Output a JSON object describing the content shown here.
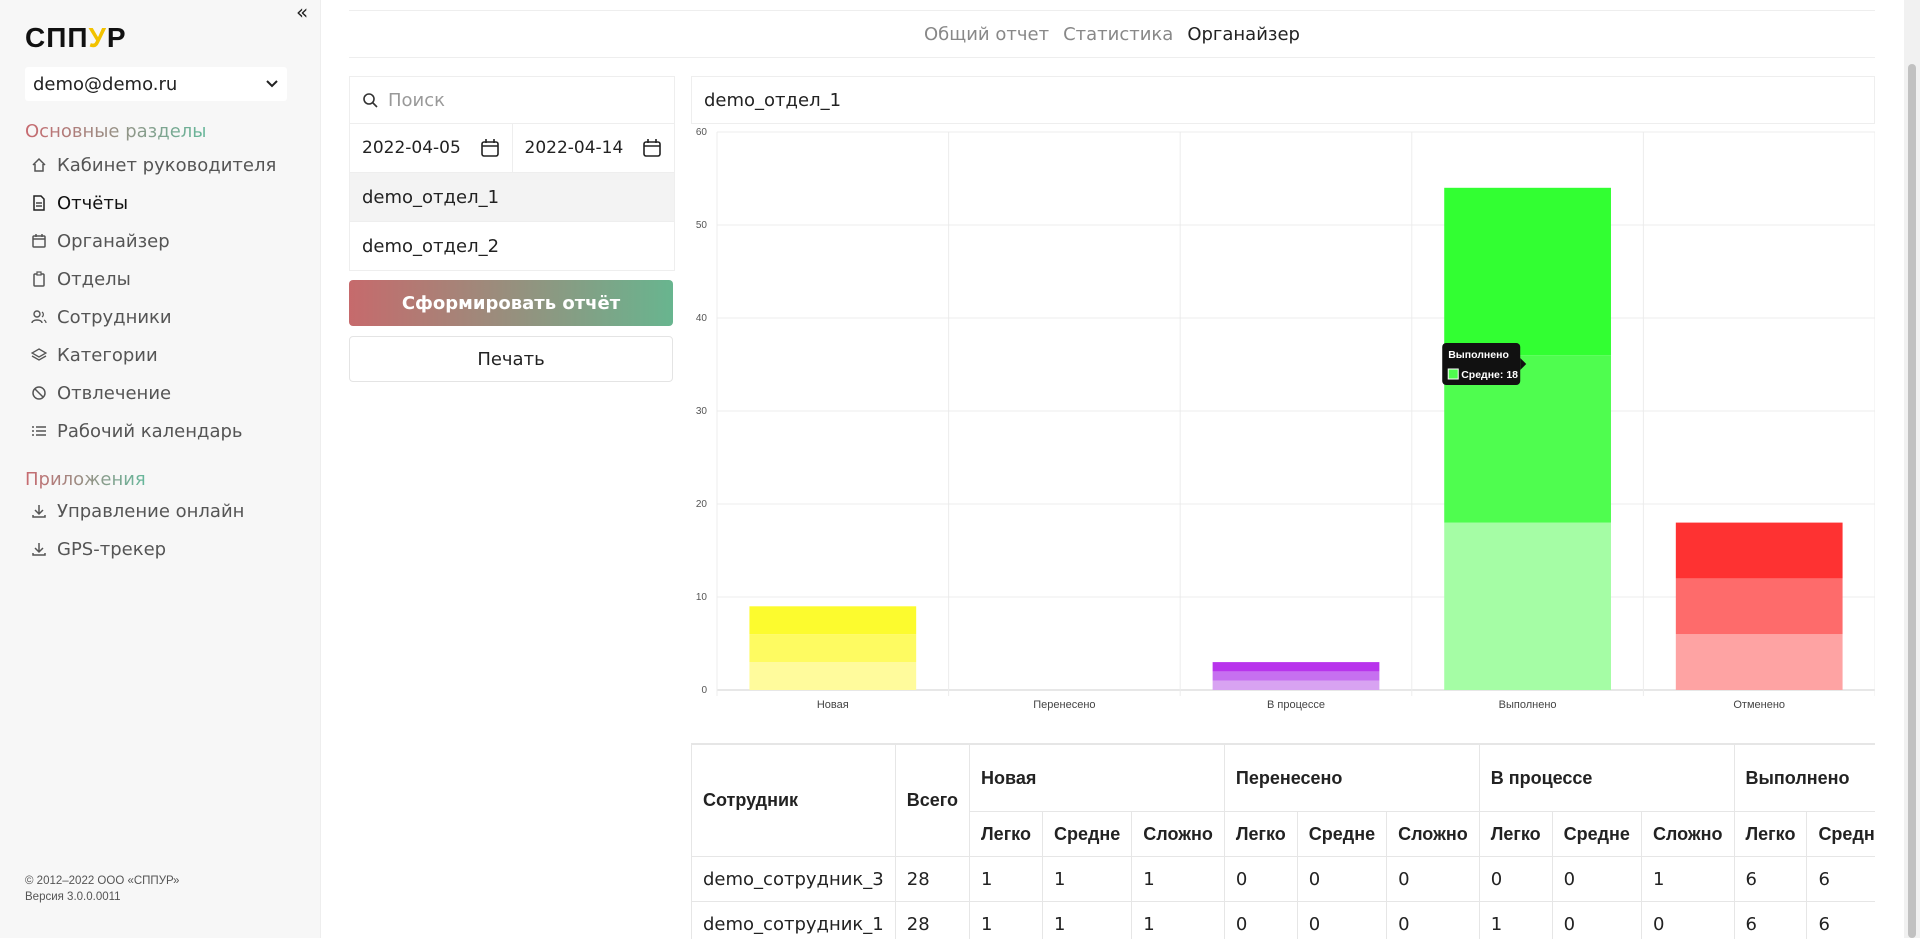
{
  "sidebar": {
    "logo_pre": "СПП",
    "logo_mark": "У",
    "logo_post": "Р",
    "account": "demo@demo.ru",
    "section_main": "Основные разделы",
    "items_main": [
      {
        "label": "Кабинет руководителя",
        "icon": "home-icon"
      },
      {
        "label": "Отчёты",
        "icon": "document-icon"
      },
      {
        "label": "Органайзер",
        "icon": "calendar-icon"
      },
      {
        "label": "Отделы",
        "icon": "clipboard-icon"
      },
      {
        "label": "Сотрудники",
        "icon": "users-icon"
      },
      {
        "label": "Категории",
        "icon": "layers-icon"
      },
      {
        "label": "Отвлечение",
        "icon": "ban-icon"
      },
      {
        "label": "Рабочий календарь",
        "icon": "list-icon"
      }
    ],
    "section_apps": "Приложения",
    "items_apps": [
      {
        "label": "Управление онлайн",
        "icon": "download-icon"
      },
      {
        "label": "GPS-трекер",
        "icon": "download-icon"
      }
    ],
    "footer_copy": "© 2012–2022 ООО «СППУР»",
    "footer_version": "Версия 3.0.0.0011"
  },
  "tabs": [
    "Общий отчет",
    "Статистика",
    "Органайзер"
  ],
  "filters": {
    "search_placeholder": "Поиск",
    "date_from": "2022-04-05",
    "date_to": "2022-04-14",
    "departments": [
      "demo_отдел_1",
      "demo_отдел_2"
    ]
  },
  "buttons": {
    "generate": "Сформировать отчёт",
    "print": "Печать"
  },
  "chart_title": "demo_отдел_1",
  "chart_data": {
    "type": "bar",
    "stacked": true,
    "categories": [
      "Новая",
      "Перенесено",
      "В процессе",
      "Выполнено",
      "Отменено"
    ],
    "series": [
      {
        "name": "Легко",
        "values": [
          3,
          0,
          1,
          18,
          6
        ]
      },
      {
        "name": "Средне",
        "values": [
          3,
          0,
          1,
          18,
          6
        ]
      },
      {
        "name": "Сложно",
        "values": [
          3,
          0,
          1,
          18,
          6
        ]
      }
    ],
    "colors": {
      "Новая": [
        "#fffb9c",
        "#fefb61",
        "#fcfb2e"
      ],
      "Перенесено": [
        "#cccccc",
        "#aaaaaa",
        "#888888"
      ],
      "В процессе": [
        "#d8a3f2",
        "#c670f0",
        "#b834ec"
      ],
      "Выполнено": [
        "#a5fda5",
        "#4ffd4f",
        "#32ff32"
      ],
      "Отменено": [
        "#fea3a3",
        "#fe6b6b",
        "#fe3232"
      ]
    },
    "ylim": [
      0,
      60
    ],
    "yticks": [
      0,
      10,
      20,
      30,
      40,
      50,
      60
    ],
    "grid": true,
    "tooltip": {
      "title": "Выполнено",
      "label": "Средне: 18"
    }
  },
  "table": {
    "col_employee": "Сотрудник",
    "col_total": "Всего",
    "groups": [
      "Новая",
      "Перенесено",
      "В процессе",
      "Выполнено"
    ],
    "subcols": [
      "Легко",
      "Средне",
      "Сложно",
      "Легко",
      "Средне",
      "Сложно",
      "Легко",
      "Средне",
      "Сложно",
      "Легко",
      "Средне"
    ],
    "rows": [
      {
        "name": "demo_сотрудник_3",
        "cells": [
          "28",
          "1",
          "1",
          "1",
          "0",
          "0",
          "0",
          "0",
          "0",
          "1",
          "6",
          "6"
        ]
      },
      {
        "name": "demo_сотрудник_1",
        "cells": [
          "28",
          "1",
          "1",
          "1",
          "0",
          "0",
          "0",
          "1",
          "0",
          "0",
          "6",
          "6"
        ]
      }
    ]
  }
}
